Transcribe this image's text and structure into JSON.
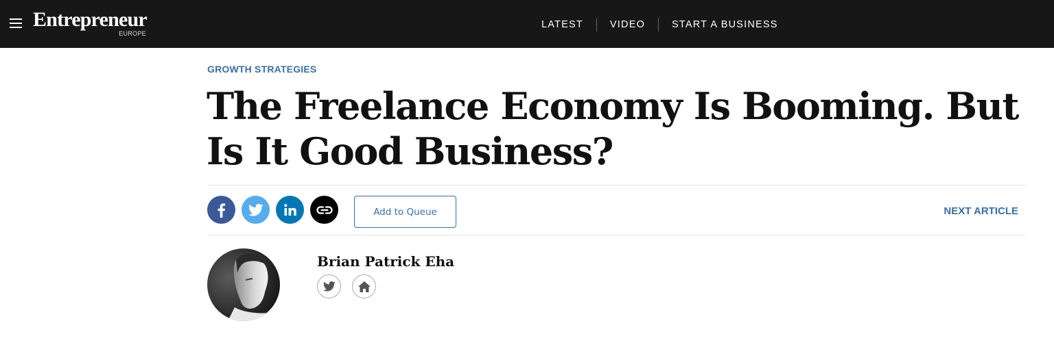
{
  "header": {
    "menu_icon": "hamburger-menu-icon",
    "logo": {
      "name": "Entrepreneur",
      "edition": "EUROPE"
    },
    "nav": [
      {
        "label": "LATEST"
      },
      {
        "label": "VIDEO"
      },
      {
        "label": "START A BUSINESS"
      }
    ]
  },
  "article": {
    "category": "GROWTH STRATEGIES",
    "headline": "The Freelance Economy Is Booming. But Is It Good Business?",
    "share": {
      "icons": [
        "facebook-icon",
        "twitter-icon",
        "linkedin-icon",
        "link-icon"
      ],
      "colors": {
        "facebook": "#3b5998",
        "twitter": "#55acee",
        "linkedin": "#0077b5",
        "link": "#000000"
      }
    },
    "queue_label": "Add to Queue",
    "next_label": "NEXT ARTICLE",
    "author": {
      "name": "Brian Patrick Eha",
      "links": [
        "twitter-icon",
        "home-icon"
      ]
    }
  },
  "theme": {
    "accent": "#3b6fa5",
    "header_bg": "#171717"
  }
}
